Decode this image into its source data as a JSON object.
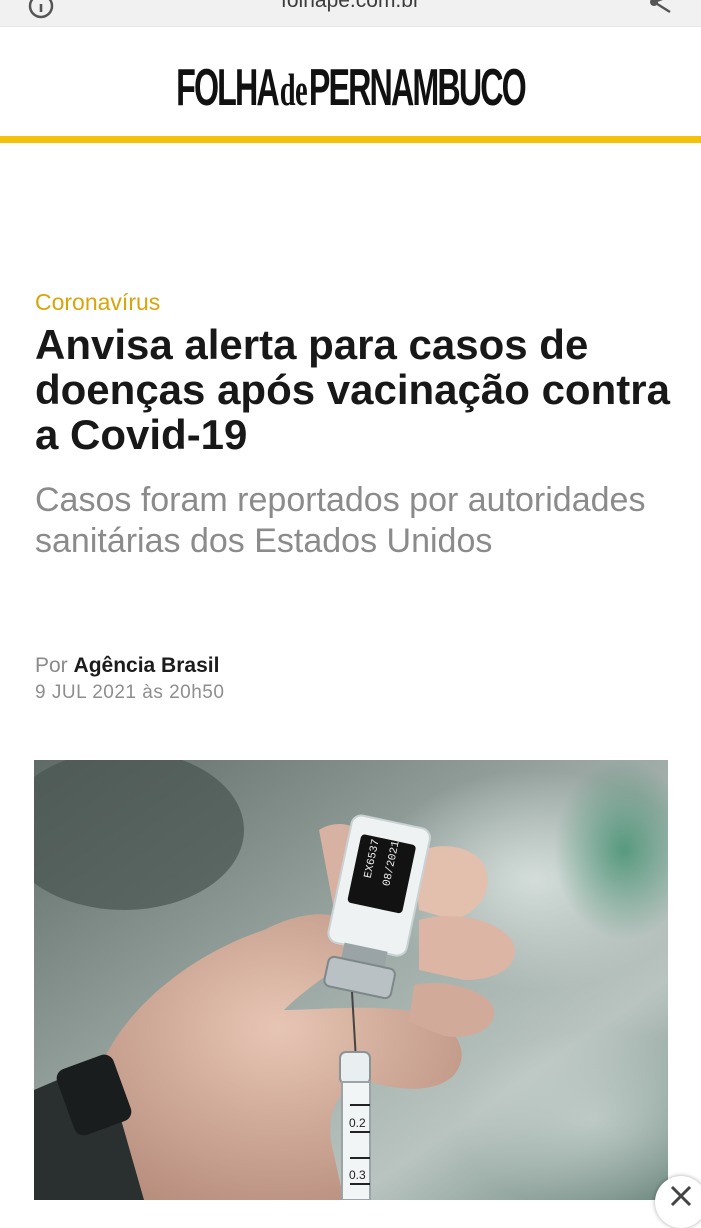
{
  "browser": {
    "url": "folhape.com.br",
    "info_icon": "info-circle-icon",
    "share_icon": "share-icon"
  },
  "site": {
    "logo_left": "FOLHA",
    "logo_mid": "de",
    "logo_right": "PERNAMBUCO",
    "accent_color": "#f4c20d"
  },
  "article": {
    "category": "Coronavírus",
    "headline": "Anvisa alerta para casos de doenças após vacinação contra a Covid-19",
    "subtitle": "Casos foram reportados por autoridades sanitárias dos Estados Unidos",
    "byline_prefix": "Por",
    "author": "Agência Brasil",
    "date": "9 JUL 2021 às 20h50",
    "category_color": "#d9a408"
  },
  "photo": {
    "vial_label_line1": "EX6537",
    "vial_label_line2": "08/2021",
    "syringe_mark_1": "0.2",
    "syringe_mark_2": "0.3"
  },
  "overlay": {
    "close_icon": "close-icon"
  }
}
